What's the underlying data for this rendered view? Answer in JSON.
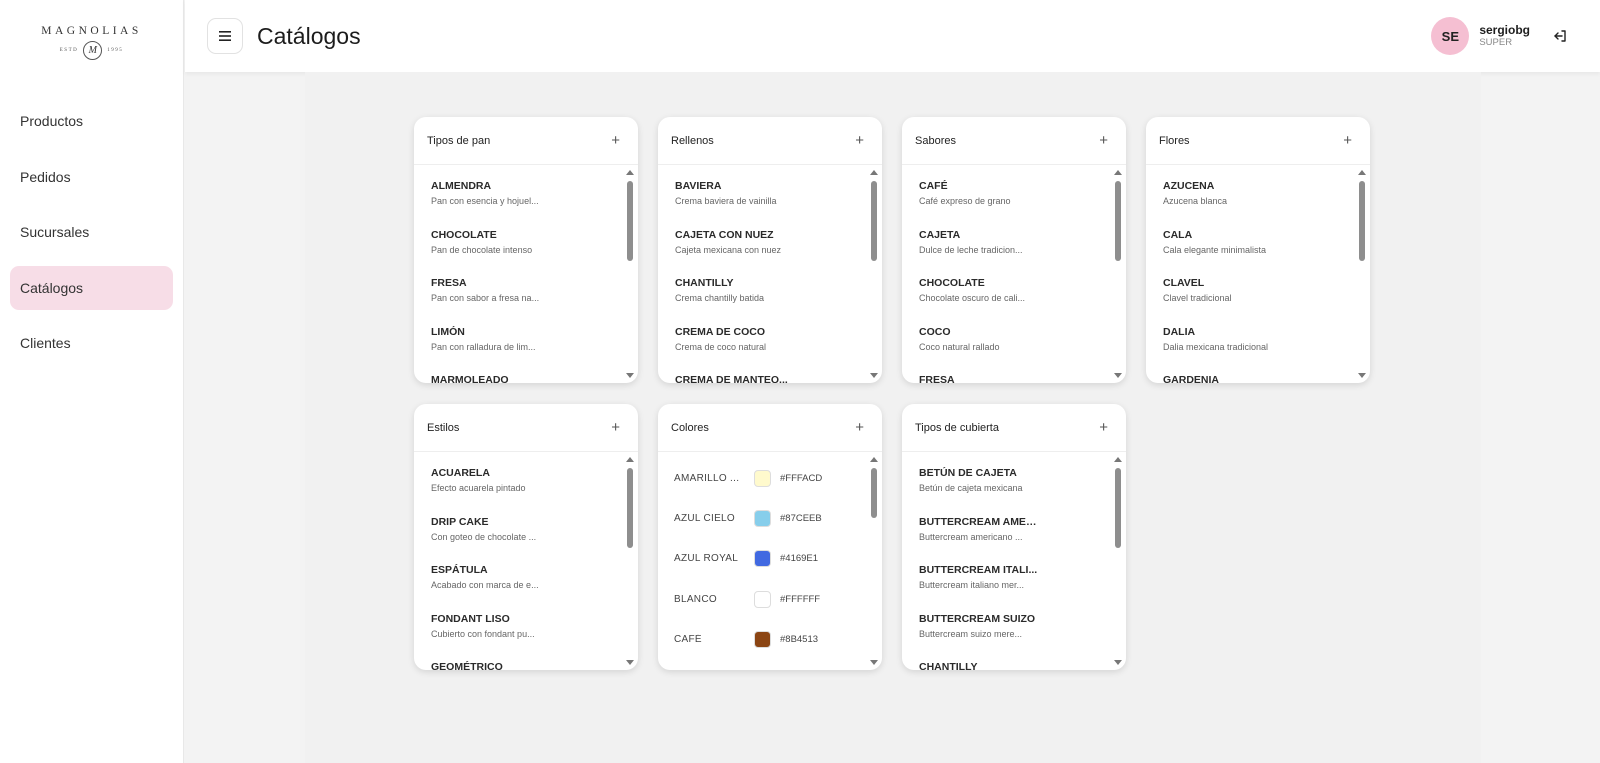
{
  "logo": {
    "name": "MAGNOLIAS",
    "estd": "ESTD",
    "monogram": "M",
    "year": "1995"
  },
  "nav": [
    {
      "label": "Productos",
      "active": false
    },
    {
      "label": "Pedidos",
      "active": false
    },
    {
      "label": "Sucursales",
      "active": false
    },
    {
      "label": "Catálogos",
      "active": true
    },
    {
      "label": "Clientes",
      "active": false
    }
  ],
  "header": {
    "title": "Catálogos"
  },
  "user": {
    "initials": "SE",
    "name": "sergiobg",
    "role": "SUPER"
  },
  "catalogs": [
    {
      "title": "Tipos de pan",
      "items": [
        {
          "name": "ALMENDRA",
          "desc": "Pan con esencia y hojuel..."
        },
        {
          "name": "CHOCOLATE",
          "desc": "Pan de chocolate intenso"
        },
        {
          "name": "FRESA",
          "desc": "Pan con sabor a fresa na..."
        },
        {
          "name": "LIMÓN",
          "desc": "Pan con ralladura de lim..."
        },
        {
          "name": "MARMOLEADO",
          "desc": ""
        }
      ]
    },
    {
      "title": "Rellenos",
      "items": [
        {
          "name": "BAVIERA",
          "desc": "Crema baviera de vainilla"
        },
        {
          "name": "CAJETA CON NUEZ",
          "desc": "Cajeta mexicana con nuez"
        },
        {
          "name": "CHANTILLY",
          "desc": "Crema chantilly batida"
        },
        {
          "name": "CREMA DE COCO",
          "desc": "Crema de coco natural"
        },
        {
          "name": "CREMA DE MANTEQ...",
          "desc": ""
        }
      ]
    },
    {
      "title": "Sabores",
      "items": [
        {
          "name": "CAFÉ",
          "desc": "Café expreso de grano"
        },
        {
          "name": "CAJETA",
          "desc": "Dulce de leche tradicion..."
        },
        {
          "name": "CHOCOLATE",
          "desc": "Chocolate oscuro de cali..."
        },
        {
          "name": "COCO",
          "desc": "Coco natural rallado"
        },
        {
          "name": "FRESA",
          "desc": ""
        }
      ]
    },
    {
      "title": "Flores",
      "items": [
        {
          "name": "AZUCENA",
          "desc": "Azucena blanca"
        },
        {
          "name": "CALA",
          "desc": "Cala elegante minimalista"
        },
        {
          "name": "CLAVEL",
          "desc": "Clavel tradicional"
        },
        {
          "name": "DALIA",
          "desc": "Dalia mexicana tradicional"
        },
        {
          "name": "GARDENIA",
          "desc": ""
        }
      ]
    },
    {
      "title": "Estilos",
      "items": [
        {
          "name": "ACUARELA",
          "desc": "Efecto acuarela pintado"
        },
        {
          "name": "DRIP CAKE",
          "desc": "Con goteo de chocolate ..."
        },
        {
          "name": "ESPÁTULA",
          "desc": "Acabado con marca de e..."
        },
        {
          "name": "FONDANT LISO",
          "desc": "Cubierto con fondant pu..."
        },
        {
          "name": "GEOMÉTRICO",
          "desc": ""
        }
      ]
    },
    {
      "title": "Colores",
      "colors": [
        {
          "name": "AMARILLO ...",
          "hex": "#FFFACD"
        },
        {
          "name": "AZUL CIELO",
          "hex": "#87CEEB"
        },
        {
          "name": "AZUL ROYAL",
          "hex": "#4169E1"
        },
        {
          "name": "BLANCO",
          "hex": "#FFFFFF"
        },
        {
          "name": "CAFÉ",
          "hex": "#8B4513"
        }
      ]
    },
    {
      "title": "Tipos de cubierta",
      "items": [
        {
          "name": "BETÚN DE CAJETA",
          "desc": "Betún de cajeta mexicana"
        },
        {
          "name": "BUTTERCREAM AMER...",
          "desc": "Buttercream americano ..."
        },
        {
          "name": "BUTTERCREAM ITALI...",
          "desc": "Buttercream italiano mer..."
        },
        {
          "name": "BUTTERCREAM SUIZO",
          "desc": "Buttercream suizo mere..."
        },
        {
          "name": "CHANTILLY",
          "desc": ""
        }
      ]
    }
  ]
}
